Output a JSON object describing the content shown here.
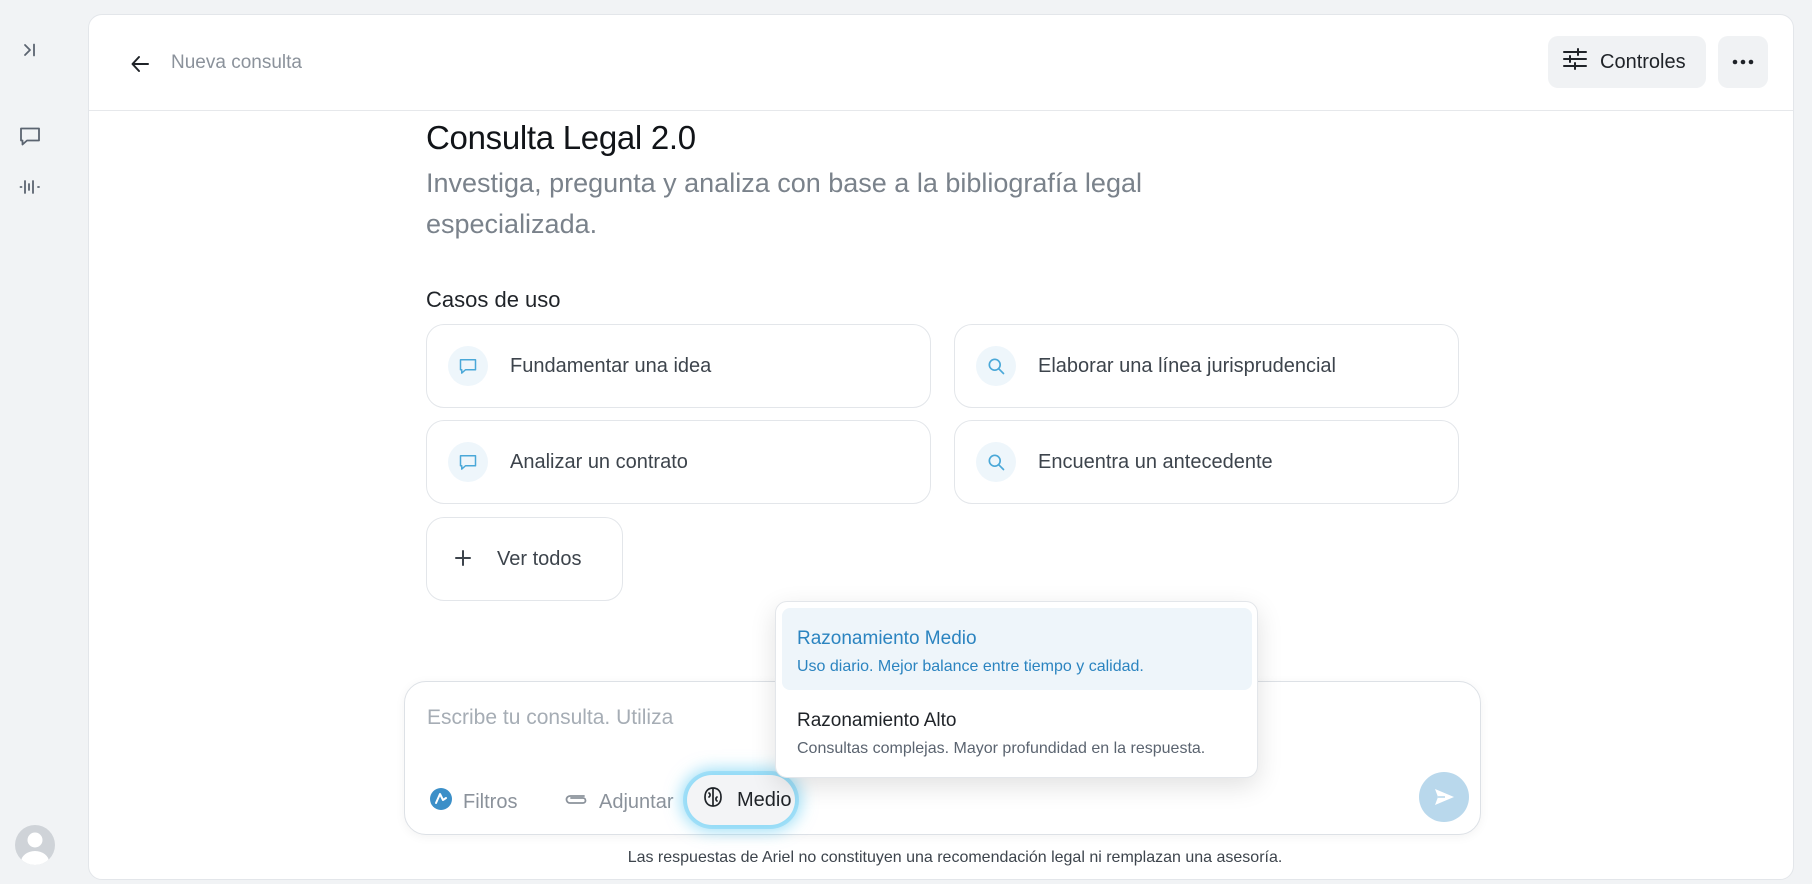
{
  "sidebar": {
    "icons": [
      "expand-sidebar-icon",
      "chat-bubble-icon",
      "audio-waveform-icon"
    ],
    "avatar_icon": "user-avatar-icon"
  },
  "header": {
    "title": "Nueva consulta",
    "controls_label": "Controles",
    "more_icon": "more-horizontal-icon"
  },
  "hero": {
    "title": "Consulta Legal 2.0",
    "subtitle": "Investiga, pregunta y analiza con base a la bibliografía legal especializada."
  },
  "use_cases": {
    "label": "Casos de uso",
    "items": [
      {
        "label": "Fundamentar una idea",
        "icon": "chat-bubble-icon"
      },
      {
        "label": "Elaborar una línea jurisprudencial",
        "icon": "search-icon"
      },
      {
        "label": "Analizar un contrato",
        "icon": "chat-bubble-icon"
      },
      {
        "label": "Encuentra un antecedente",
        "icon": "search-icon"
      }
    ],
    "view_all": "Ver todos"
  },
  "composer": {
    "placeholder": "Escribe tu consulta. Utiliza",
    "filters_label": "Filtros",
    "attach_label": "Adjuntar",
    "reasoning_label": "Medio"
  },
  "reasoning_menu": {
    "options": [
      {
        "title": "Razonamiento Medio",
        "description": "Uso diario. Mejor balance entre tiempo y calidad.",
        "selected": true
      },
      {
        "title": "Razonamiento Alto",
        "description": "Consultas complejas. Mayor profundidad en la respuesta.",
        "selected": false
      }
    ]
  },
  "disclaimer": "Las respuestas de Ariel no constituyen una recomendación legal ni remplazan una asesoría.",
  "colors": {
    "accent": "#2b84c0",
    "selected_bg": "#eef5fa",
    "send_button": "#b9d8ec",
    "focus_glow": "#5ac8f0"
  }
}
